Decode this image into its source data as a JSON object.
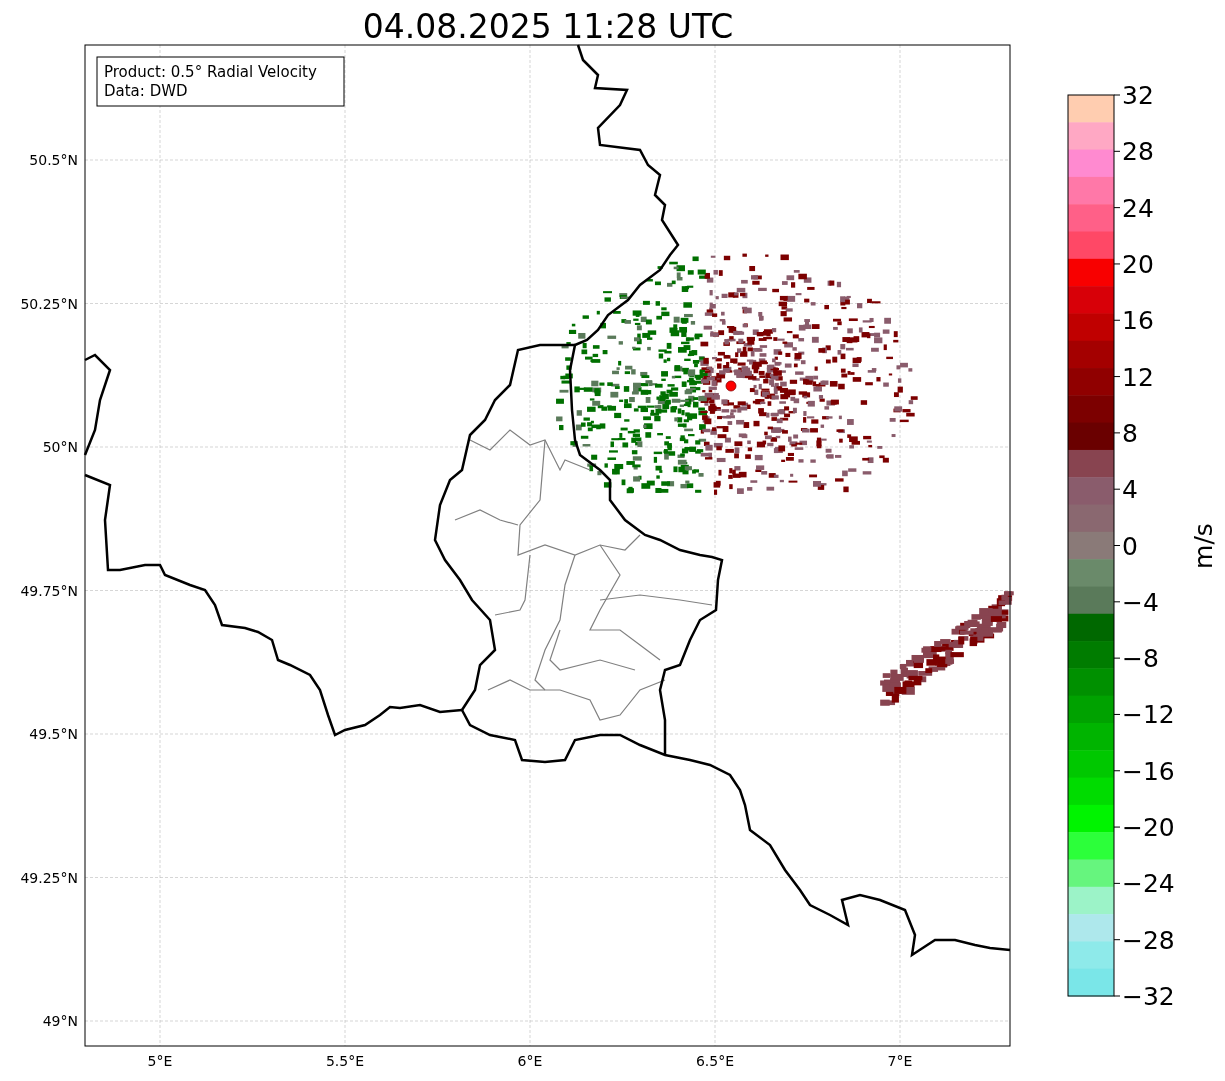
{
  "title": "04.08.2025 11:28 UTC",
  "info_box": {
    "lines": [
      "Product: 0.5° Radial Velocity",
      "Data: DWD"
    ]
  },
  "map": {
    "lat_labels": [
      "50.5°N",
      "50.25°N",
      "50°N",
      "49.75°N",
      "49.5°N",
      "49.25°N",
      "49°N"
    ],
    "lon_labels": [
      "5°E",
      "5.5°E",
      "6°E",
      "6.5°E",
      "7°E"
    ]
  },
  "colorbar": {
    "label": "m/s",
    "ticks": [
      "32",
      "28",
      "24",
      "20",
      "16",
      "12",
      "8",
      "4",
      "0",
      "−4",
      "−8",
      "−12",
      "−16",
      "−20",
      "−24",
      "−28",
      "−32"
    ],
    "bins": [
      {
        "color": "#ffcdb0"
      },
      {
        "color": "#ffa8c4"
      },
      {
        "color": "#ff8ad0"
      },
      {
        "color": "#ff78a8"
      },
      {
        "color": "#ff6088"
      },
      {
        "color": "#ff4866"
      },
      {
        "color": "#f80000"
      },
      {
        "color": "#d80008"
      },
      {
        "color": "#c00000"
      },
      {
        "color": "#a40000"
      },
      {
        "color": "#900000"
      },
      {
        "color": "#7c0000"
      },
      {
        "color": "#6a0000"
      },
      {
        "color": "#884450"
      },
      {
        "color": "#8a5c6c"
      },
      {
        "color": "#8a6870"
      },
      {
        "color": "#8a7a78"
      },
      {
        "color": "#6a8a6a"
      },
      {
        "color": "#5a7a5a"
      },
      {
        "color": "#006800"
      },
      {
        "color": "#007c00"
      },
      {
        "color": "#009000"
      },
      {
        "color": "#00a200"
      },
      {
        "color": "#00b400"
      },
      {
        "color": "#00c800"
      },
      {
        "color": "#00dc00"
      },
      {
        "color": "#00f400"
      },
      {
        "color": "#2cff3a"
      },
      {
        "color": "#66f57e"
      },
      {
        "color": "#9cf3c8"
      },
      {
        "color": "#aee8ec"
      },
      {
        "color": "#8eeaea"
      },
      {
        "color": "#7ae6e8"
      }
    ]
  }
}
